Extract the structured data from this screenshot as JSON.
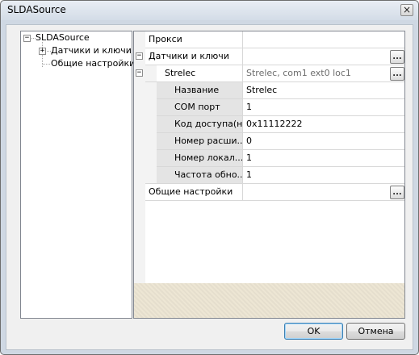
{
  "window": {
    "title": "SLDASource",
    "close_glyph": "×"
  },
  "tree": {
    "root_label": "SLDASource",
    "items": [
      {
        "label": "Датчики и ключи",
        "expander": "+"
      },
      {
        "label": "Общие настройки"
      }
    ],
    "root_expander": "−"
  },
  "grid": {
    "rows": [
      {
        "name": "Прокси",
        "value": ""
      },
      {
        "name": "Датчики и ключи",
        "value": "",
        "expander": "−"
      },
      {
        "name": "Strelec",
        "value": "Strelec, com1 ext0 loc1",
        "expander": "−"
      },
      {
        "name": "Название",
        "value": "Strelec"
      },
      {
        "name": "COM порт",
        "value": "1"
      },
      {
        "name": "Код доступа(н...",
        "value": "0x11112222"
      },
      {
        "name": "Номер расши...",
        "value": "0"
      },
      {
        "name": "Номер локал...",
        "value": "1"
      },
      {
        "name": "Частота обно...",
        "value": "1"
      },
      {
        "name": "Общие настройки",
        "value": ""
      }
    ],
    "ellipsis": "..."
  },
  "buttons": {
    "ok": "OK",
    "cancel": "Отмена"
  }
}
